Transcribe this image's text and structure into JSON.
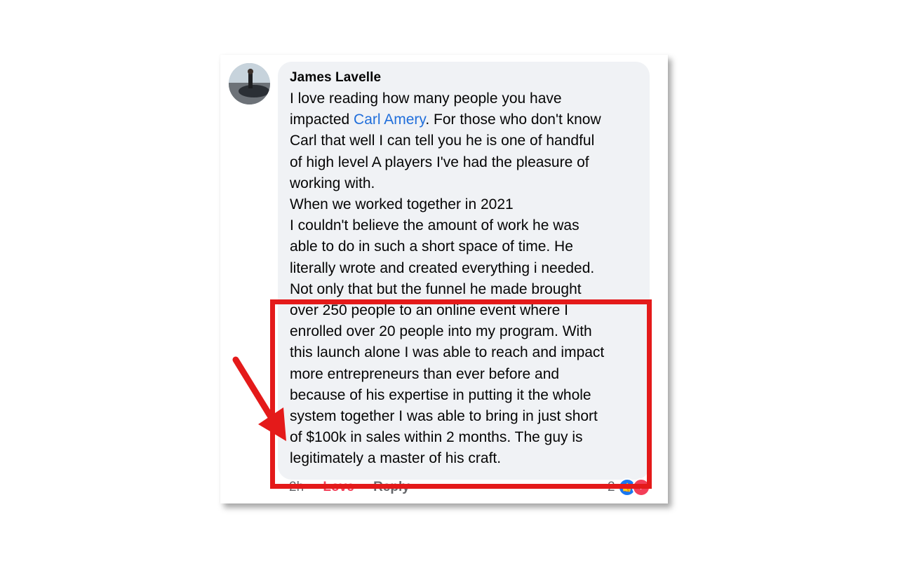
{
  "comment": {
    "author": "James Lavelle",
    "lines": [
      {
        "pre": "I love reading how many people you have",
        "mention": "",
        "post": ""
      },
      {
        "pre": "impacted ",
        "mention": "Carl Amery",
        "post": ". For those who don't know"
      },
      {
        "pre": "Carl that well I can tell you he is one of handful",
        "mention": "",
        "post": ""
      },
      {
        "pre": "of high level A players I've had the pleasure of",
        "mention": "",
        "post": ""
      },
      {
        "pre": "working with.",
        "mention": "",
        "post": ""
      },
      {
        "pre": "When we worked together in 2021",
        "mention": "",
        "post": ""
      },
      {
        "pre": "I couldn't believe the amount of work he was",
        "mention": "",
        "post": ""
      },
      {
        "pre": "able to do in such a short space of time. He",
        "mention": "",
        "post": ""
      },
      {
        "pre": "literally wrote and created everything i needed.",
        "mention": "",
        "post": ""
      },
      {
        "pre": "Not only that but the funnel he made brought",
        "mention": "",
        "post": ""
      },
      {
        "pre": "over 250 people to an online event where I",
        "mention": "",
        "post": ""
      },
      {
        "pre": "enrolled over 20 people into my program. With",
        "mention": "",
        "post": ""
      },
      {
        "pre": "this launch alone I was able to reach and impact",
        "mention": "",
        "post": ""
      },
      {
        "pre": "more entrepreneurs than ever before and",
        "mention": "",
        "post": ""
      },
      {
        "pre": "because of his expertise in putting it the whole",
        "mention": "",
        "post": ""
      },
      {
        "pre": "system together I was able to bring in just short",
        "mention": "",
        "post": ""
      },
      {
        "pre": "of $100k in sales within 2 months. The guy is",
        "mention": "",
        "post": ""
      },
      {
        "pre": "legitimately a master of his craft.",
        "mention": "",
        "post": ""
      }
    ]
  },
  "actions": {
    "time": "2h",
    "love_label": "Love",
    "reply_label": "Reply"
  },
  "reactions": {
    "count": "2",
    "icons": [
      "like-icon",
      "love-icon"
    ]
  },
  "annotation": {
    "box_color": "#e41a1a",
    "arrow_color": "#e41a1a"
  },
  "colors": {
    "mention": "#216fdb",
    "love": "#f33e58",
    "bubble": "#f0f2f5",
    "like": "#1877f2"
  }
}
